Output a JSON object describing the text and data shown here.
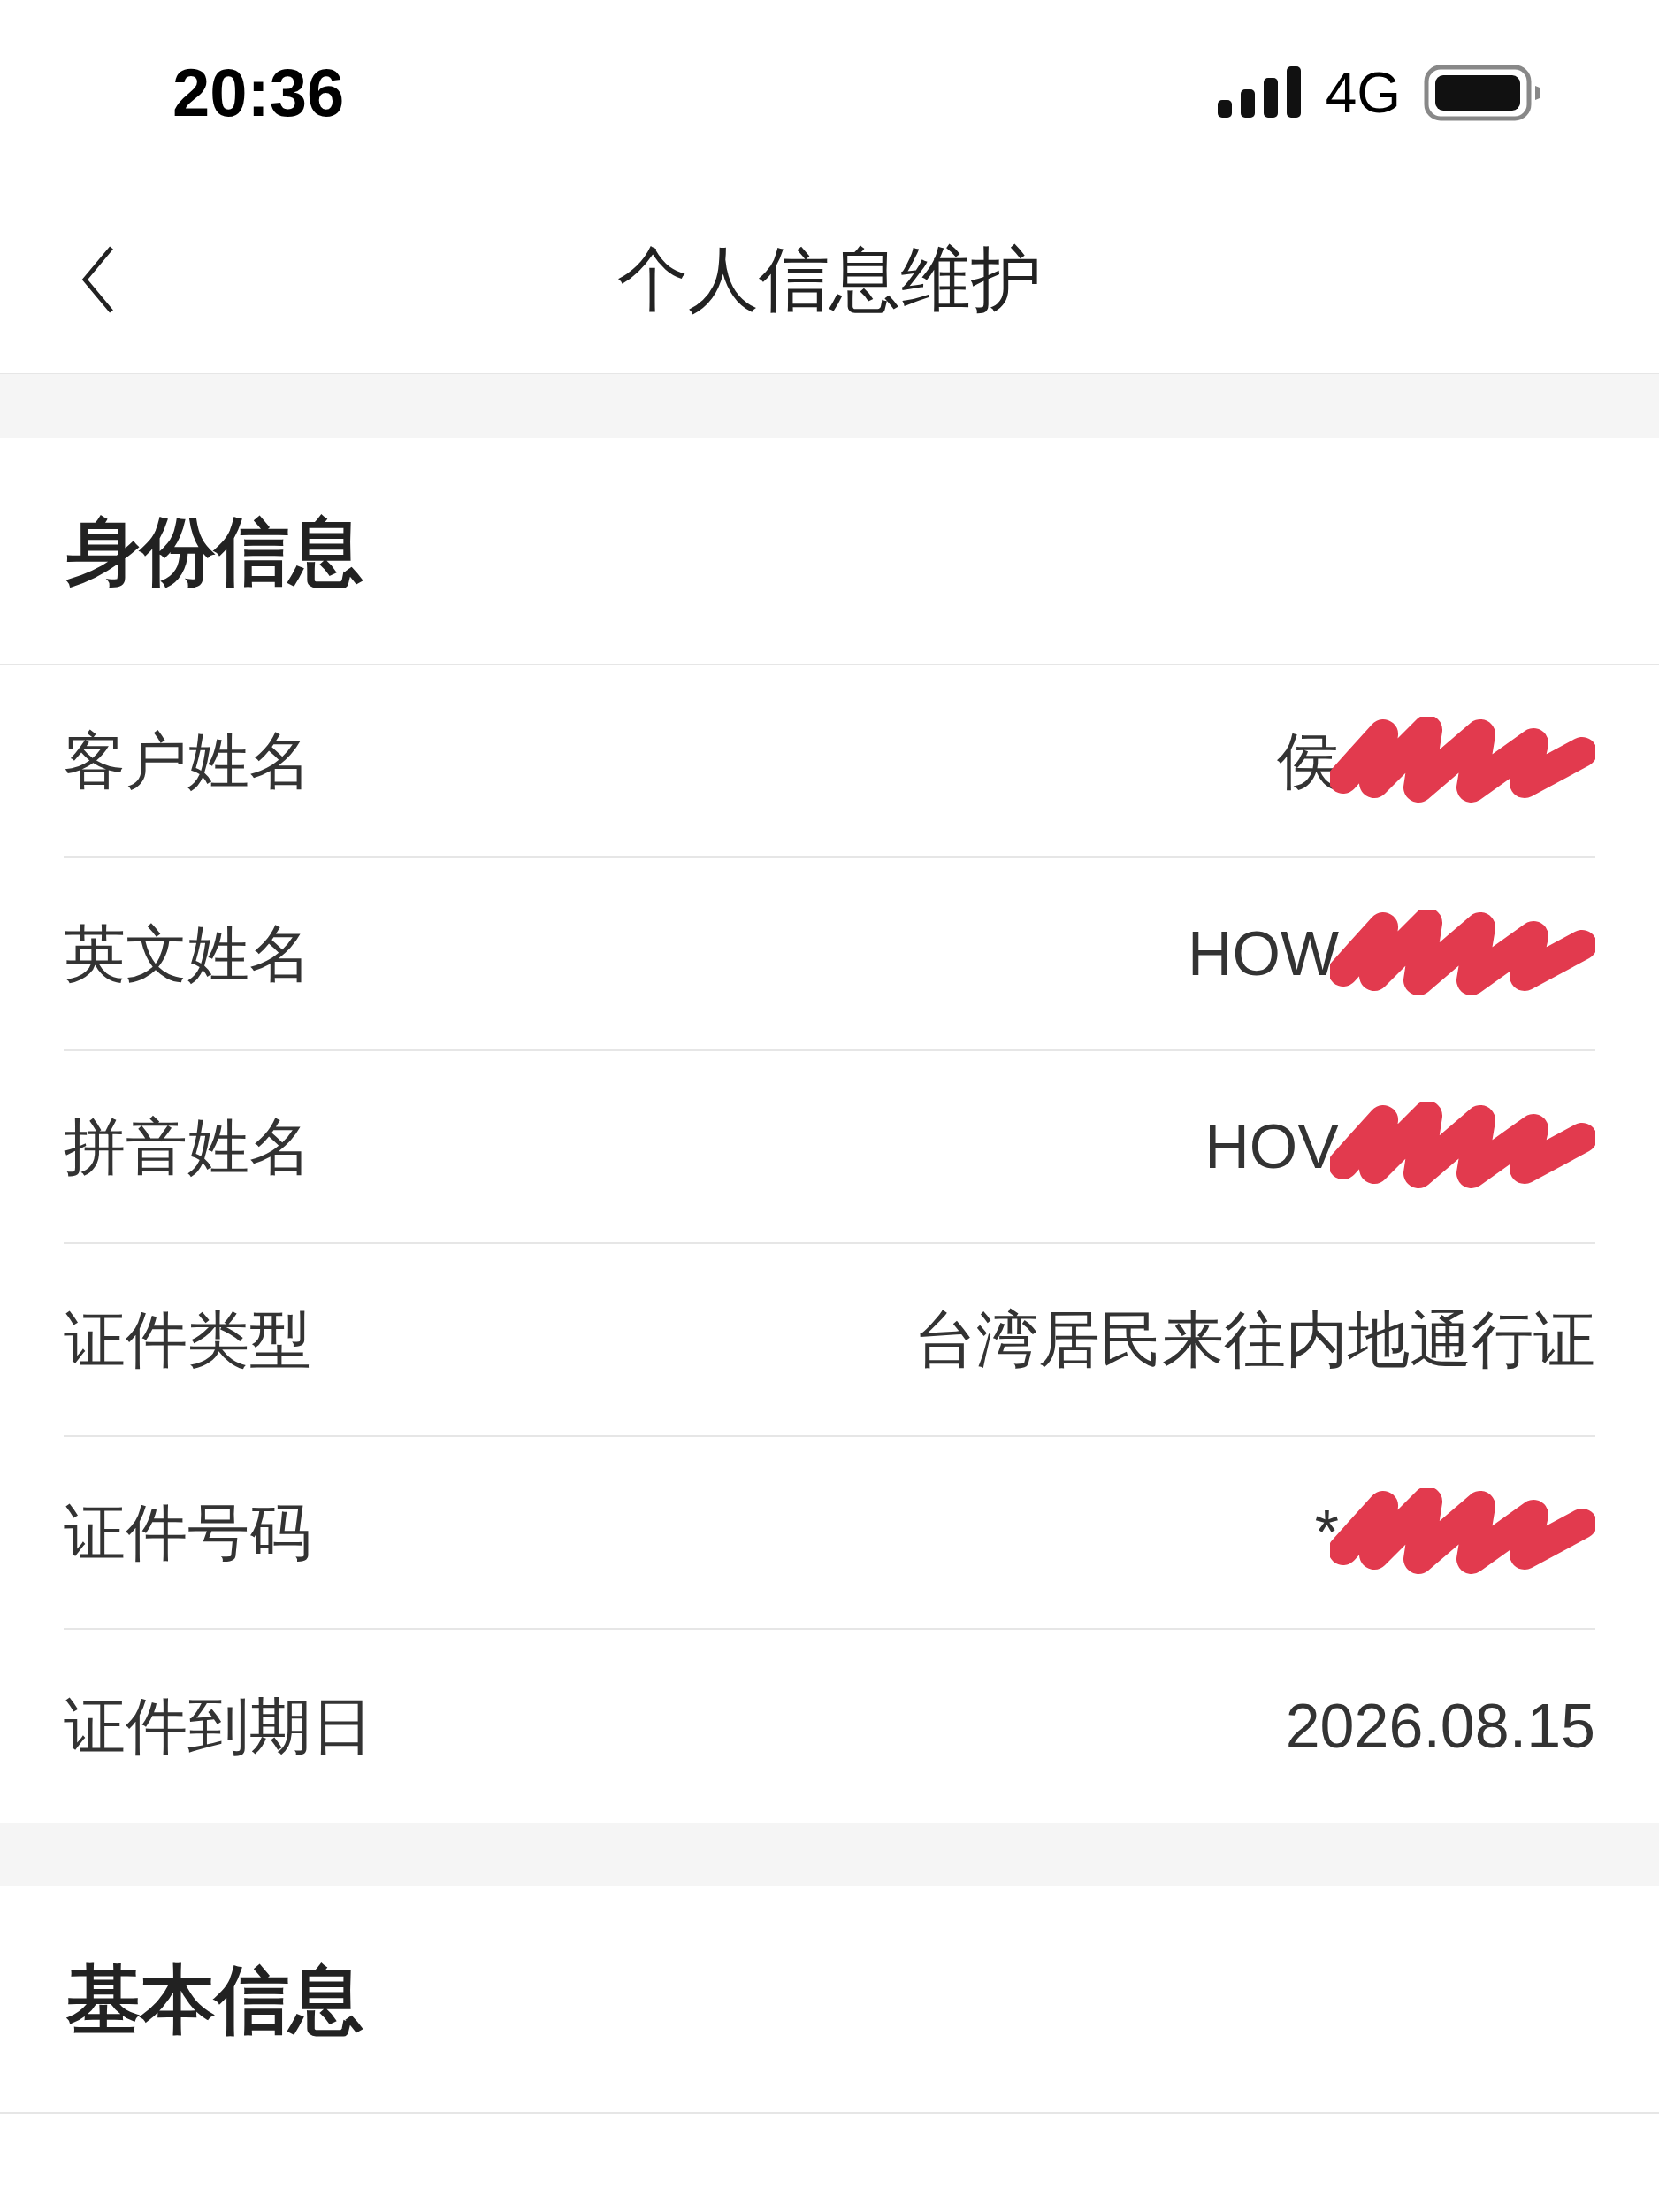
{
  "status_bar": {
    "time": "20:36",
    "network": "4G"
  },
  "nav": {
    "title": "个人信息维护"
  },
  "sections": [
    {
      "title": "身份信息",
      "rows": [
        {
          "label": "客户姓名",
          "value": "侯",
          "redacted": true
        },
        {
          "label": "英文姓名",
          "value": "HOW",
          "redacted": true
        },
        {
          "label": "拼音姓名",
          "value": "HOV",
          "redacted": true
        },
        {
          "label": "证件类型",
          "value": "台湾居民来往内地通行证",
          "redacted": false
        },
        {
          "label": "证件号码",
          "value": "*",
          "redacted": true
        },
        {
          "label": "证件到期日",
          "value": "2026.08.15",
          "redacted": false
        }
      ]
    },
    {
      "title": "基本信息"
    }
  ]
}
